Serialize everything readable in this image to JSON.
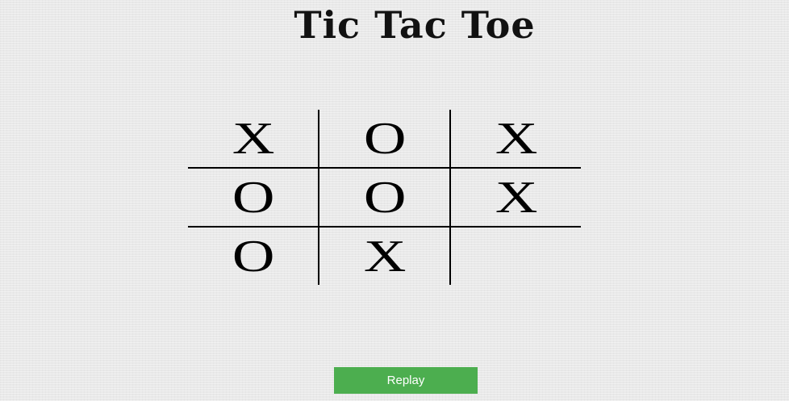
{
  "title": "Tic Tac Toe",
  "board": {
    "cells": [
      "X",
      "O",
      "X",
      "O",
      "O",
      "X",
      "O",
      "X",
      ""
    ]
  },
  "replay_label": "Replay",
  "colors": {
    "background": "#e9e9e9",
    "button": "#4cae4f",
    "button_text": "#ffffff",
    "marks": "#000000"
  }
}
